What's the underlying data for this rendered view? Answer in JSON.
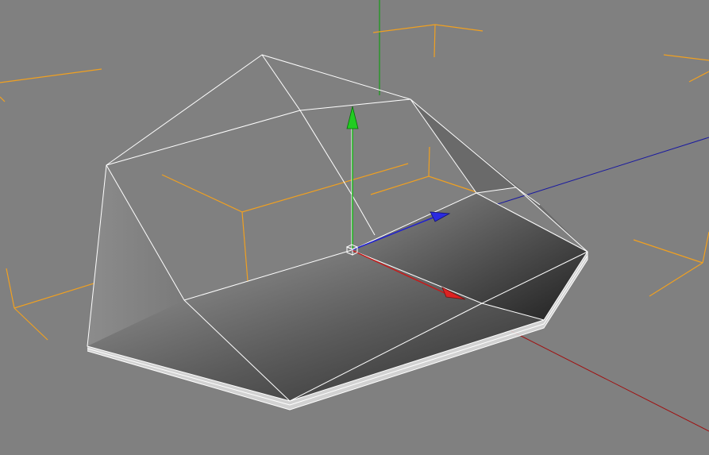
{
  "viewport": {
    "background": "#808080",
    "colors": {
      "axis_x": "#c00000",
      "axis_y": "#00a000",
      "axis_z": "#0000c0",
      "wire": "#ffffff",
      "camera_guides": "#f0a020"
    },
    "icons": {
      "x_axis_handle": "red-cone-arrow",
      "y_axis_handle": "green-cone-arrow",
      "z_axis_handle": "blue-cone-arrow",
      "object_center": "white-cube"
    }
  }
}
